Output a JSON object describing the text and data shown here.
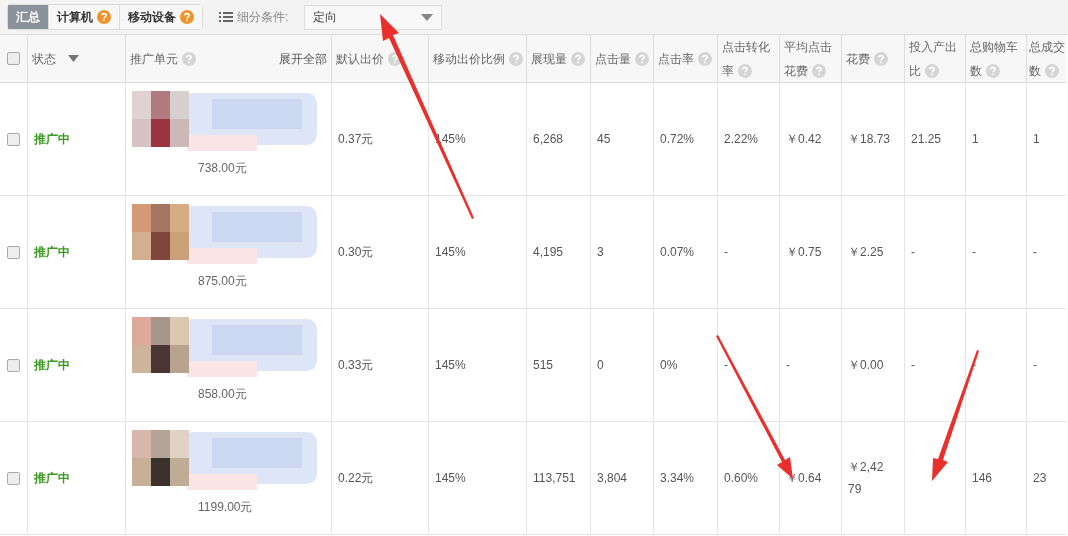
{
  "tabs": [
    {
      "label": "汇总",
      "selected": true,
      "help": false
    },
    {
      "label": "计算机",
      "selected": false,
      "help": true
    },
    {
      "label": "移动设备",
      "selected": false,
      "help": true
    }
  ],
  "filter": {
    "label": "细分条件:",
    "value": "定向"
  },
  "table": {
    "header_checked": false,
    "columns": [
      {
        "lines": [
          "状态"
        ],
        "sortable": true,
        "help": false
      },
      {
        "lines": [
          "推广单元"
        ],
        "help": true,
        "action": "展开全部"
      },
      {
        "lines": [
          "默认出价"
        ],
        "help": true
      },
      {
        "lines": [
          "移动出价比例"
        ],
        "help": true
      },
      {
        "lines": [
          "展现量"
        ],
        "help": true
      },
      {
        "lines": [
          "点击量"
        ],
        "help": true
      },
      {
        "lines": [
          "点击率"
        ],
        "help": true
      },
      {
        "lines": [
          "点击转化",
          "率"
        ],
        "help": true
      },
      {
        "lines": [
          "平均点击",
          "花费"
        ],
        "help": true
      },
      {
        "lines": [
          "花费"
        ],
        "help": true
      },
      {
        "lines": [
          "投入产出",
          "比"
        ],
        "help": true
      },
      {
        "lines": [
          "总购物车",
          "数"
        ],
        "help": true
      },
      {
        "lines": [
          "总成交",
          "数"
        ],
        "help": true
      }
    ],
    "rows": [
      {
        "checked": false,
        "cells": [
          "推广中",
          {
            "kind": "picture",
            "price": "738.00元"
          },
          "0.37元",
          "145%",
          "6,268",
          "45",
          "0.72%",
          "2.22%",
          "￥0.42",
          "￥18.73",
          "21.25",
          "1",
          "1"
        ]
      },
      {
        "checked": false,
        "cells": [
          "推广中",
          {
            "kind": "picture",
            "price": "875.00元"
          },
          "0.30元",
          "145%",
          "4,195",
          "3",
          "0.07%",
          "-",
          "￥0.75",
          "￥2.25",
          "-",
          "-",
          "-"
        ]
      },
      {
        "checked": false,
        "cells": [
          "推广中",
          {
            "kind": "picture",
            "price": "858.00元"
          },
          "0.33元",
          "145%",
          "515",
          "0",
          "0%",
          "-",
          "-",
          "￥0.00",
          "-",
          "-",
          "-"
        ]
      },
      {
        "checked": false,
        "cells": [
          "推广中",
          {
            "kind": "picture",
            "price": "1199.00元"
          },
          "0.22元",
          "145%",
          "113,751",
          "3,804",
          "3.34%",
          "0.60%",
          "￥0.64",
          "￥2,42\n79",
          null,
          "146",
          "23"
        ]
      }
    ]
  }
}
